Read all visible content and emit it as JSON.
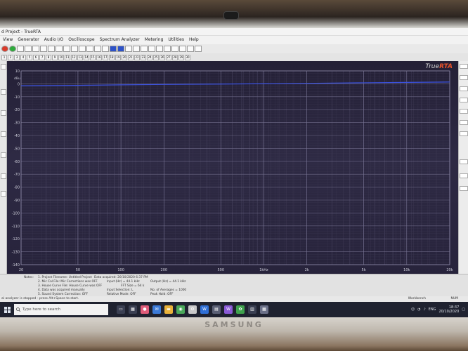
{
  "window": {
    "title": "d Project - TrueRTA"
  },
  "menu": [
    "View",
    "Generator",
    "Audio I/O",
    "Oscilloscope",
    "Spectrum Analyzer",
    "Metering",
    "Utilities",
    "Help"
  ],
  "toolbar1": [
    "",
    "",
    "",
    "",
    "",
    "",
    "",
    "",
    "",
    "",
    "",
    "",
    "",
    "",
    "",
    "",
    "",
    "",
    "",
    "",
    "",
    "",
    "",
    "",
    "",
    "",
    "",
    "",
    "",
    "",
    "",
    ""
  ],
  "toolbar2": [
    "1",
    "2",
    "3",
    "4",
    "5",
    "6",
    "7",
    "8",
    "9",
    "10",
    "11",
    "12",
    "13",
    "14",
    "15",
    "16",
    "17",
    "18",
    "19",
    "20",
    "21",
    "22",
    "23",
    "24",
    "25",
    "26",
    "27",
    "28",
    "29",
    "30"
  ],
  "logo": {
    "prefix": "True",
    "accent": "RTA"
  },
  "chart_data": {
    "type": "line",
    "xlabel": "",
    "ylabel": "dBu",
    "x_scale": "log",
    "xlim": [
      20,
      20000
    ],
    "ylim": [
      -140,
      10
    ],
    "y_ticks": [
      10,
      0,
      -10,
      -20,
      -30,
      -40,
      -50,
      -60,
      -70,
      -80,
      -90,
      -100,
      -110,
      -120,
      -130,
      -140
    ],
    "x_ticks": [
      {
        "value": 20,
        "label": "20"
      },
      {
        "value": 50,
        "label": "50"
      },
      {
        "value": 100,
        "label": "100"
      },
      {
        "value": 200,
        "label": "200"
      },
      {
        "value": 500,
        "label": "500"
      },
      {
        "value": 1000,
        "label": "1kHz"
      },
      {
        "value": 2000,
        "label": "2k"
      },
      {
        "value": 5000,
        "label": "5k"
      },
      {
        "value": 10000,
        "label": "10k"
      },
      {
        "value": 20000,
        "label": "20k"
      }
    ],
    "grid": true,
    "series": [
      {
        "color": "#3b52e0",
        "x": [
          20,
          50,
          100,
          200,
          500,
          1000,
          2000,
          5000,
          10000,
          20000
        ],
        "y": [
          -1.5,
          -1.2,
          -0.8,
          -0.5,
          -0.2,
          0.1,
          0.4,
          0.8,
          1.1,
          1.4
        ]
      }
    ]
  },
  "notes": {
    "heading": "Notes:",
    "items": [
      "1. Project Filename: Untitled Project",
      "2. Mic Cal File: Mic Corrections was OFF",
      "3. House Curve File: House Curve was OFF",
      "4. Data was acquired manually",
      "5. Sound System Correction: OFF"
    ],
    "col2": [
      "Data acquired: 20/10/2020 6:37 PM",
      "Input (Hz) = 44.1 kHz",
      "FFT Size = 64 k",
      "Input Selection: L",
      "Relative Mode: OFF"
    ],
    "col3": [
      "Output (Hz) = 44.1 kHz",
      "",
      "No. of Averages = 1000",
      "Peak Hold: OFF"
    ]
  },
  "status": {
    "left": "al analyzer is stopped - press Alt+Space to start.",
    "center": "Workbench",
    "num": "NUM"
  },
  "taskbar": {
    "search_placeholder": "Type here to search",
    "lang": "ENG",
    "time": "18:37",
    "date": "20/10/2020"
  },
  "laptop": {
    "brand": "SAMSUNG"
  }
}
